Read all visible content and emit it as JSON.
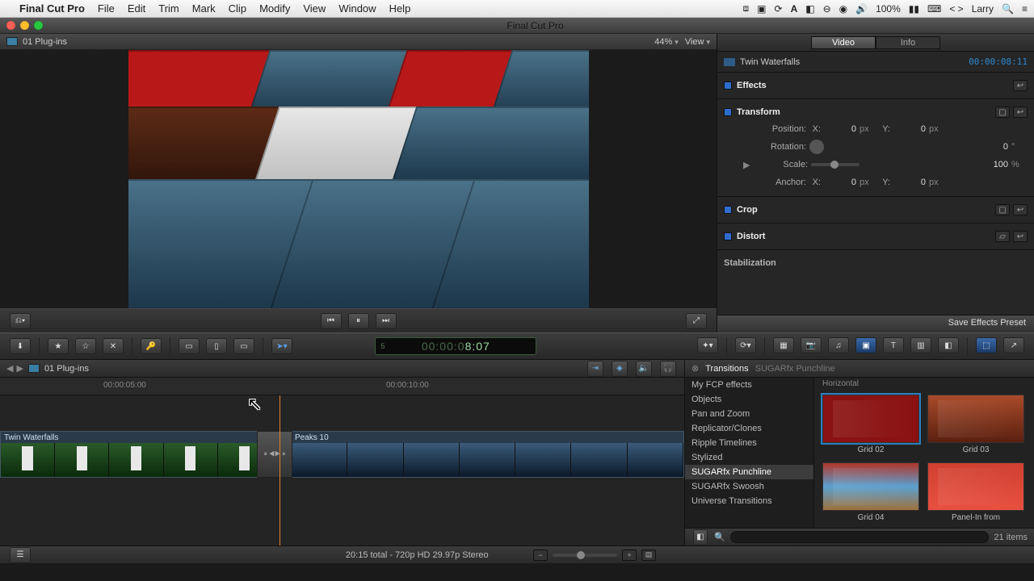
{
  "menubar": {
    "app": "Final Cut Pro",
    "items": [
      "File",
      "Edit",
      "Trim",
      "Mark",
      "Clip",
      "Modify",
      "View",
      "Window",
      "Help"
    ],
    "battery": "100%",
    "user": "Larry"
  },
  "window": {
    "title": "Final Cut Pro"
  },
  "viewer": {
    "project_name": "01 Plug-ins",
    "zoom": "44%",
    "view_label": "View"
  },
  "inspector": {
    "tabs": {
      "video": "Video",
      "info": "Info"
    },
    "clip_name": "Twin Waterfalls",
    "clip_tc": "00:00:08:11",
    "sections": {
      "effects": "Effects",
      "transform": {
        "title": "Transform",
        "position_label": "Position:",
        "x_label": "X:",
        "x_val": "0",
        "y_label": "Y:",
        "y_val": "0",
        "px": "px",
        "rotation_label": "Rotation:",
        "rotation_val": "0",
        "rotation_unit": "°",
        "scale_label": "Scale:",
        "scale_val": "100",
        "scale_unit": "%",
        "anchor_label": "Anchor:"
      },
      "crop": "Crop",
      "distort": "Distort",
      "stabilization": "Stabilization"
    },
    "save_preset": "Save Effects Preset"
  },
  "timecode": {
    "dim": "00:00:0",
    "bright": "8:07"
  },
  "timeline": {
    "project_name": "01 Plug-ins",
    "ruler": {
      "t1": "00:00:05:00",
      "t2": "00:00:10:00"
    },
    "clip1": "Twin Waterfalls",
    "clip2": "Peaks 10"
  },
  "browser": {
    "crumb1": "Transitions",
    "crumb2": "SUGARfx Punchline",
    "categories": [
      "My FCP effects",
      "Objects",
      "Pan and Zoom",
      "Replicator/Clones",
      "Ripple Timelines",
      "Stylized",
      "SUGARfx Punchline",
      "SUGARfx Swoosh",
      "Universe Transitions"
    ],
    "group_heading": "Horizontal",
    "thumbs": [
      "Grid 02",
      "Grid 03",
      "Grid 04",
      "Panel-In from"
    ],
    "count": "21 items",
    "search_placeholder": ""
  },
  "bottom": {
    "info": "20:15 total - 720p HD 29.97p Stereo"
  }
}
